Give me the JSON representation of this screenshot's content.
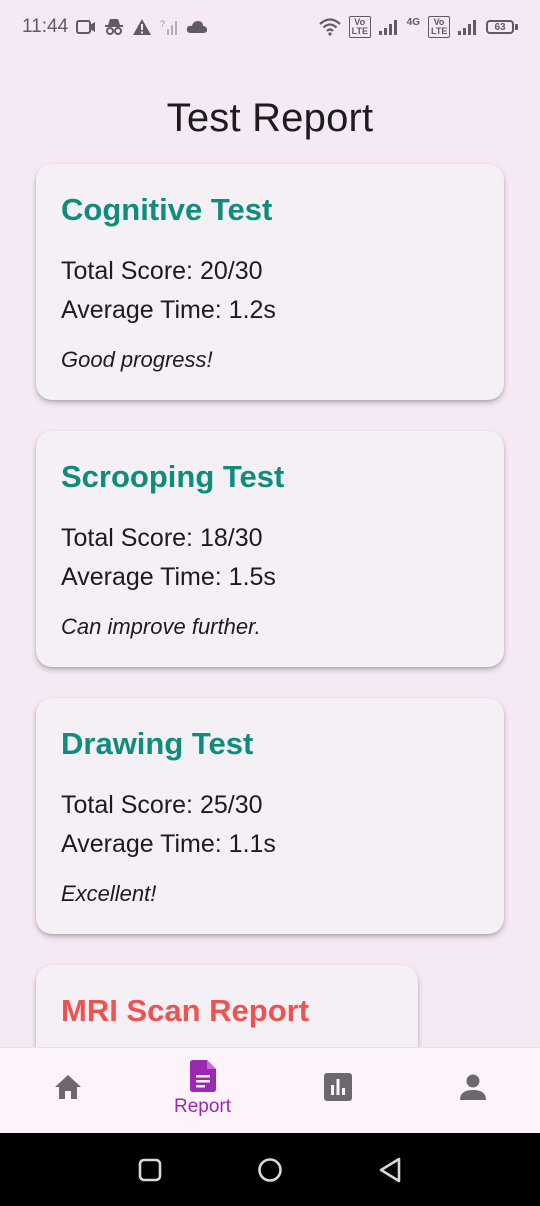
{
  "status_bar": {
    "time": "11:44",
    "left_icons": [
      "screen-record-icon",
      "incognito-icon",
      "warning-icon",
      "no-signal-icon",
      "cloud-icon"
    ],
    "volte1": "Vo LTE",
    "network": "4G",
    "volte2": "Vo LTE",
    "battery": "63"
  },
  "page": {
    "title": "Test Report"
  },
  "cards": [
    {
      "title": "Cognitive Test",
      "score": "Total Score: 20/30",
      "time": "Average Time: 1.2s",
      "note": "Good progress!"
    },
    {
      "title": "Scrooping Test",
      "score": "Total Score: 18/30",
      "time": "Average Time: 1.5s",
      "note": "Can improve further."
    },
    {
      "title": "Drawing Test",
      "score": "Total Score: 25/30",
      "time": "Average Time: 1.1s",
      "note": "Excellent!"
    },
    {
      "title": "MRI Scan Report"
    }
  ],
  "bottom_nav": {
    "items": [
      {
        "icon": "home-icon",
        "label": ""
      },
      {
        "icon": "report-icon",
        "label": "Report",
        "active": true
      },
      {
        "icon": "bar-chart-icon",
        "label": ""
      },
      {
        "icon": "person-icon",
        "label": ""
      }
    ]
  },
  "colors": {
    "background": "#f6e9f6",
    "card_title": "#0f8d7c",
    "mri_title": "#ef5350",
    "active_nav": "#9c27b0"
  }
}
